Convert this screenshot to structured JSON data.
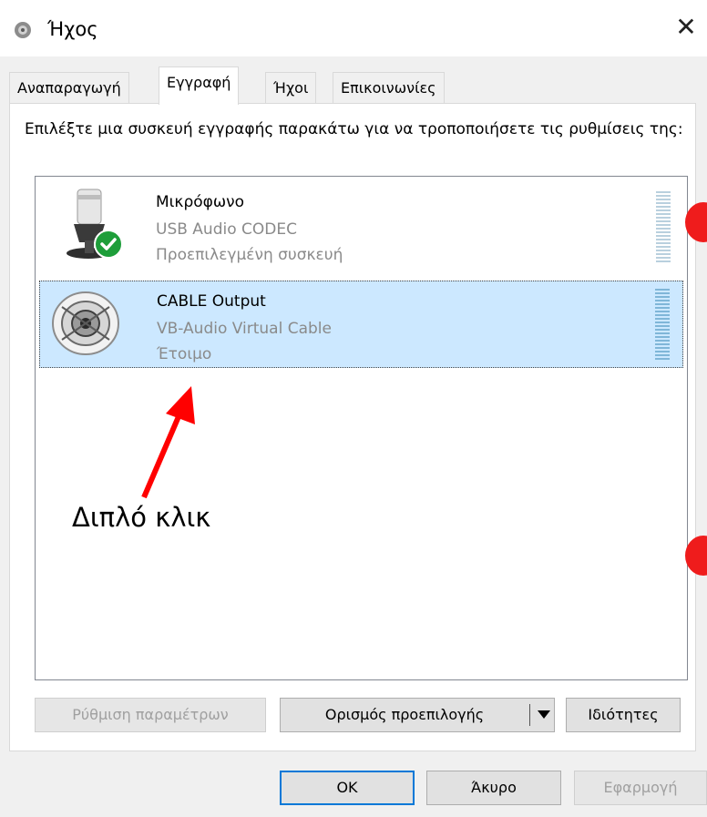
{
  "window": {
    "title": "Ήχος",
    "close_glyph": "✕"
  },
  "tabs": [
    {
      "label": "Αναπαραγωγή",
      "active": false
    },
    {
      "label": "Εγγραφή",
      "active": true
    },
    {
      "label": "Ήχοι",
      "active": false
    },
    {
      "label": "Επικοινωνίες",
      "active": false
    }
  ],
  "instructions": "Επιλέξτε μια συσκευή εγγραφής παρακάτω για να τροποποιήσετε τις ρυθμίσεις της:",
  "devices": [
    {
      "name": "Μικρόφωνο",
      "driver": "USB Audio CODEC",
      "status": "Προεπιλεγμένη συσκευή",
      "selected": false,
      "default": true,
      "icon": "microphone-icon"
    },
    {
      "name": "CABLE Output",
      "driver": "VB-Audio Virtual Cable",
      "status": "Έτοιμο",
      "selected": true,
      "default": false,
      "icon": "cable-icon"
    }
  ],
  "buttons": {
    "configure": "Ρύθμιση παραμέτρων",
    "set_default": "Ορισμός προεπιλογής",
    "properties": "Ιδιότητες",
    "ok": "OK",
    "cancel": "Άκυρο",
    "apply": "Εφαρμογή"
  },
  "annotation": {
    "text": "Διπλό κλικ",
    "color": "#ff0000"
  },
  "colors": {
    "selection": "#cce8ff",
    "default_check": "#1e9e3a",
    "accent": "#0078d7"
  }
}
